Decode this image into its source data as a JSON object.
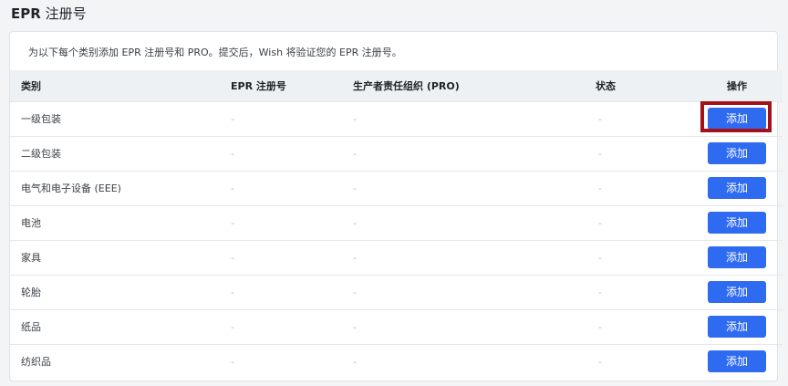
{
  "page": {
    "title_bold": "EPR",
    "title_rest": " 注册号"
  },
  "card": {
    "intro": "为以下每个类别添加 EPR 注册号和 PRO。提交后，Wish 将验证您的 EPR 注册号。"
  },
  "table": {
    "headers": {
      "category": "类别",
      "epr": "EPR 注册号",
      "pro": "生产者责任组织 (PRO)",
      "status": "状态",
      "action": "操作"
    },
    "rows": [
      {
        "category": "一级包装",
        "epr": "-",
        "pro": "-",
        "status": "-",
        "action": "添加"
      },
      {
        "category": "二级包装",
        "epr": "-",
        "pro": "-",
        "status": "-",
        "action": "添加"
      },
      {
        "category": "电气和电子设备 (EEE)",
        "epr": "-",
        "pro": "-",
        "status": "-",
        "action": "添加"
      },
      {
        "category": "电池",
        "epr": "-",
        "pro": "-",
        "status": "-",
        "action": "添加"
      },
      {
        "category": "家具",
        "epr": "-",
        "pro": "-",
        "status": "-",
        "action": "添加"
      },
      {
        "category": "轮胎",
        "epr": "-",
        "pro": "-",
        "status": "-",
        "action": "添加"
      },
      {
        "category": "纸品",
        "epr": "-",
        "pro": "-",
        "status": "-",
        "action": "添加"
      },
      {
        "category": "纺织品",
        "epr": "-",
        "pro": "-",
        "status": "-",
        "action": "添加"
      }
    ]
  },
  "colors": {
    "button": "#2f6bf0",
    "highlight": "#a3111a"
  }
}
